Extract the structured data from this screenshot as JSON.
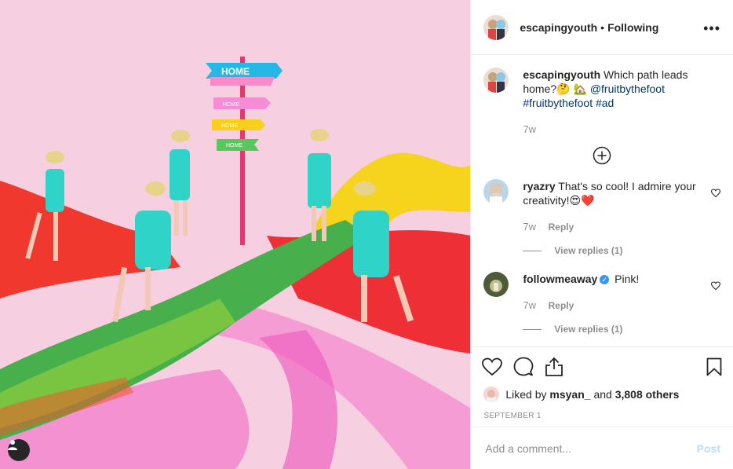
{
  "post": {
    "author": "escapingyouth",
    "follow_state": "Following",
    "separator": "•",
    "more_icon": "more-horizontal-icon",
    "caption": {
      "author": "escapingyouth",
      "text": "Which path leads home?🤔 🏡",
      "mention": "@fruitbythefoot",
      "hashtags": "#fruitbythefoot #ad",
      "age": "7w"
    },
    "comments": [
      {
        "user": "ryazry",
        "text": "That's so cool! I admire your creativity!😍❤️",
        "age": "7w",
        "reply_label": "Reply",
        "view_replies": "View replies (1)",
        "verified": false
      },
      {
        "user": "followmeaway",
        "text": "Pink!",
        "age": "7w",
        "reply_label": "Reply",
        "view_replies": "View replies (1)",
        "verified": true
      }
    ],
    "likes": {
      "prefix": "Liked by",
      "user": "msyan_",
      "joiner": "and",
      "others": "3,808 others"
    },
    "date": "SEPTEMBER 1",
    "composer": {
      "placeholder": "Add a comment...",
      "post_label": "Post"
    }
  },
  "photo": {
    "signs": [
      "HOME",
      "HOME",
      "HOME",
      "HOME",
      "HOME"
    ],
    "colors": {
      "background": "#f3c6dc",
      "red_path": "#f0342f",
      "green_path": "#3aa74a",
      "yellow_path": "#f7d21a",
      "pink_path": "#f36fc4",
      "pole": "#e8356e",
      "romper": "#2fd3c8"
    }
  },
  "icons": {
    "like": "heart-icon",
    "comment": "comment-icon",
    "share": "share-icon",
    "save": "bookmark-icon",
    "add": "plus-circle-icon",
    "user_tag": "user-tag-icon"
  }
}
